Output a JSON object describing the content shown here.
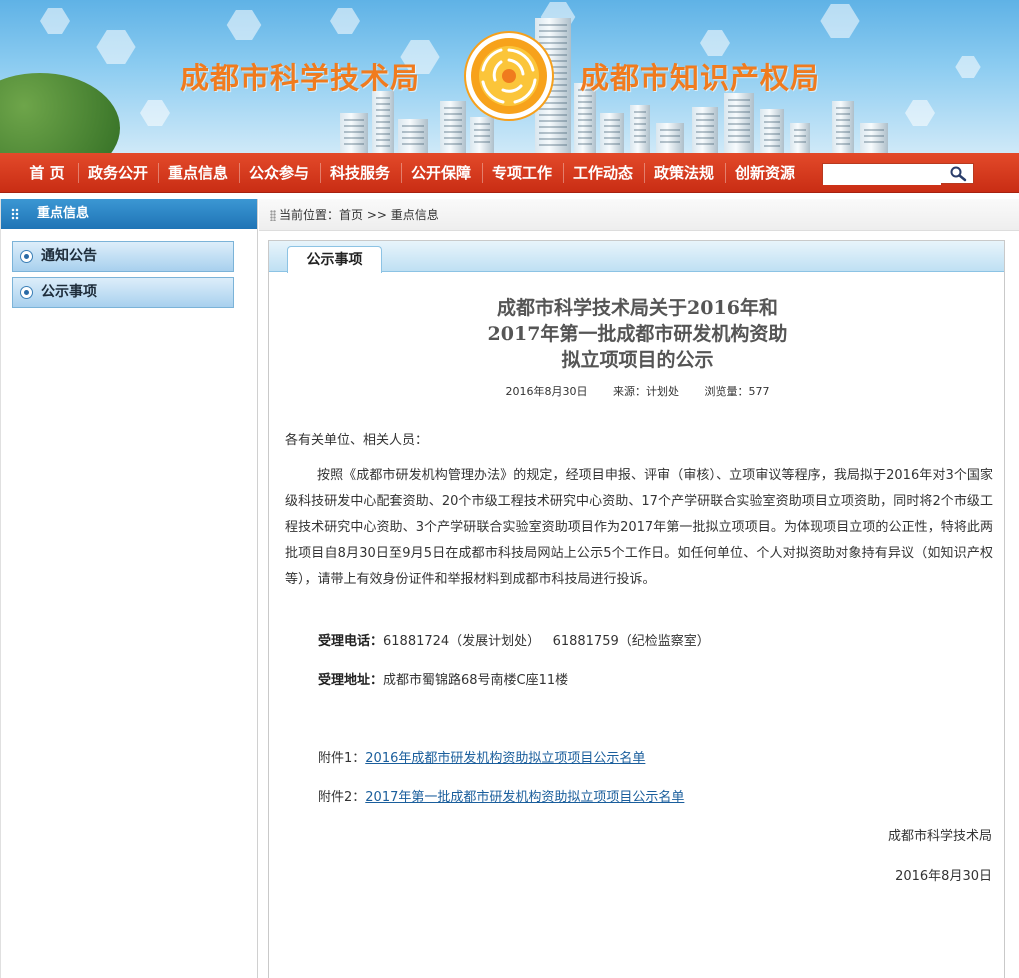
{
  "header": {
    "site_left": "成都市科学技术局",
    "site_right": "成都市知识产权局"
  },
  "nav": {
    "items": [
      "首 页",
      "政务公开",
      "重点信息",
      "公众参与",
      "科技服务",
      "公开保障",
      "专项工作",
      "工作动态",
      "政策法规",
      "创新资源"
    ],
    "search_placeholder": "",
    "search_icon": "magnifier-icon"
  },
  "sidebar": {
    "title": "重点信息",
    "items": [
      "通知公告",
      "公示事项"
    ]
  },
  "breadcrumb": {
    "prefix": "当前位置：",
    "home": "首页",
    "sep": ">>",
    "current": "重点信息"
  },
  "panel": {
    "tab": "公示事项"
  },
  "article": {
    "title_lines": [
      "成都市科学技术局关于2016年和",
      "2017年第一批成都市研发机构资助",
      "拟立项项目的公示"
    ],
    "date": "2016年8月30日",
    "source": "来源：计划处",
    "views": "浏览量：577",
    "greeting": "各有关单位、相关人员：",
    "body": "按照《成都市研发机构管理办法》的规定，经项目申报、评审（审核）、立项审议等程序，我局拟于2016年对3个国家级科技研发中心配套资助、20个市级工程技术研究中心资助、17个产学研联合实验室资助项目立项资助，同时将2个市级工程技术研究中心资助、3个产学研联合实验室资助项目作为2017年第一批拟立项项目。为体现项目立项的公正性，特将此两批项目自8月30日至9月5日在成都市科技局网站上公示5个工作日。如任何单位、个人对拟资助对象持有异议（如知识产权等），请带上有效身份证件和举报材料到成都市科技局进行投诉。",
    "phone_label": "受理电话：",
    "phone_value": "61881724（发展计划处）   61881759（纪检监察室）",
    "address_label": "受理地址：",
    "address_value": "成都市蜀锦路68号南楼C座11楼",
    "attach1_label": "附件1：",
    "attach1_link": "2016年成都市研发机构资助拟立项项目公示名单",
    "attach2_label": "附件2：",
    "attach2_link": "2017年第一批成都市研发机构资助拟立项项目公示名单",
    "signature": "成都市科学技术局",
    "sign_date": "2016年8月30日"
  },
  "colors": {
    "nav_red": "#d33a1e",
    "sidebar_blue": "#2a84c6",
    "site_orange": "#f07b1e",
    "link_blue": "#1a5e9c"
  }
}
